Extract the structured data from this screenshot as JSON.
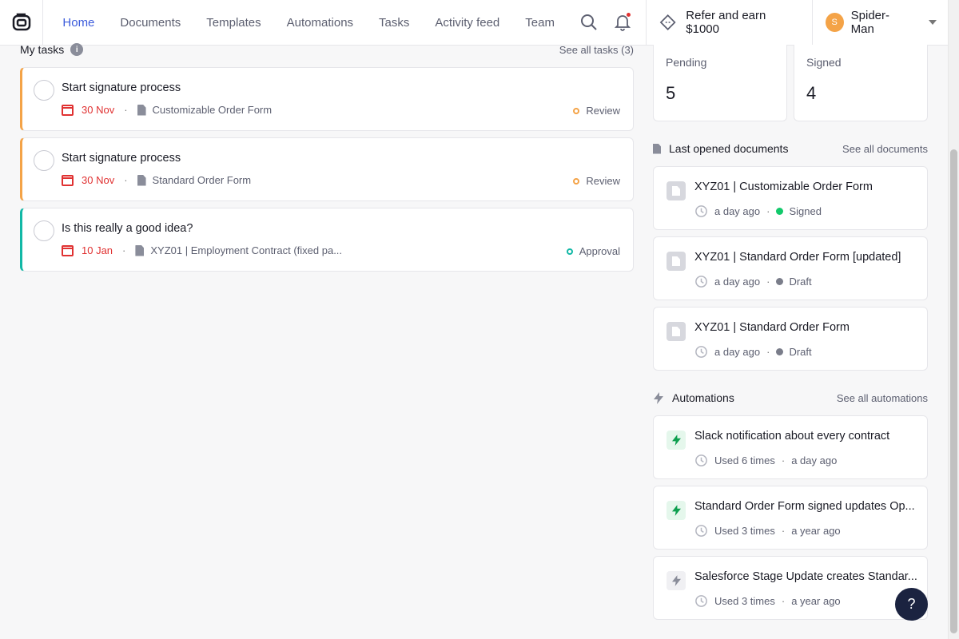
{
  "nav": {
    "items": [
      "Home",
      "Documents",
      "Templates",
      "Automations",
      "Tasks",
      "Activity feed",
      "Team"
    ],
    "active": "Home",
    "refer_label": "Refer and earn $1000",
    "user_name": "Spider-Man",
    "user_initial": "S"
  },
  "tasks": {
    "title": "My tasks",
    "see_all": "See all tasks (3)",
    "items": [
      {
        "name": "Start signature process",
        "due": "30 Nov",
        "doc": "Customizable Order Form",
        "status": "Review"
      },
      {
        "name": "Start signature process",
        "due": "30 Nov",
        "doc": "Standard Order Form",
        "status": "Review"
      },
      {
        "name": "Is this really a good idea?",
        "due": "10 Jan",
        "doc": "XYZ01 | Employment Contract (fixed pa...",
        "status": "Approval"
      }
    ]
  },
  "stats": [
    {
      "label": "Pending",
      "value": "5"
    },
    {
      "label": "Signed",
      "value": "4"
    }
  ],
  "docs": {
    "title": "Last opened documents",
    "see_all": "See all documents",
    "items": [
      {
        "title": "XYZ01 | Customizable Order Form",
        "time": "a day ago",
        "status": "Signed",
        "status_color": "#12c96b"
      },
      {
        "title": "XYZ01 | Standard Order Form [updated]",
        "time": "a day ago",
        "status": "Draft",
        "status_color": "#7a7d8a"
      },
      {
        "title": "XYZ01 | Standard Order Form",
        "time": "a day ago",
        "status": "Draft",
        "status_color": "#7a7d8a"
      }
    ]
  },
  "automations": {
    "title": "Automations",
    "see_all": "See all automations",
    "items": [
      {
        "title": "Slack notification about every contract",
        "used": "Used 6 times",
        "time": "a day ago"
      },
      {
        "title": "Standard Order Form signed updates Op...",
        "used": "Used 3 times",
        "time": "a year ago"
      },
      {
        "title": "Salesforce Stage Update creates Standar...",
        "used": "Used 3 times",
        "time": "a year ago"
      }
    ]
  },
  "help_label": "?",
  "colors": {
    "accent": "#3b5bdb",
    "review": "#f4a347",
    "approval": "#12b8a6",
    "due": "#e03131"
  }
}
